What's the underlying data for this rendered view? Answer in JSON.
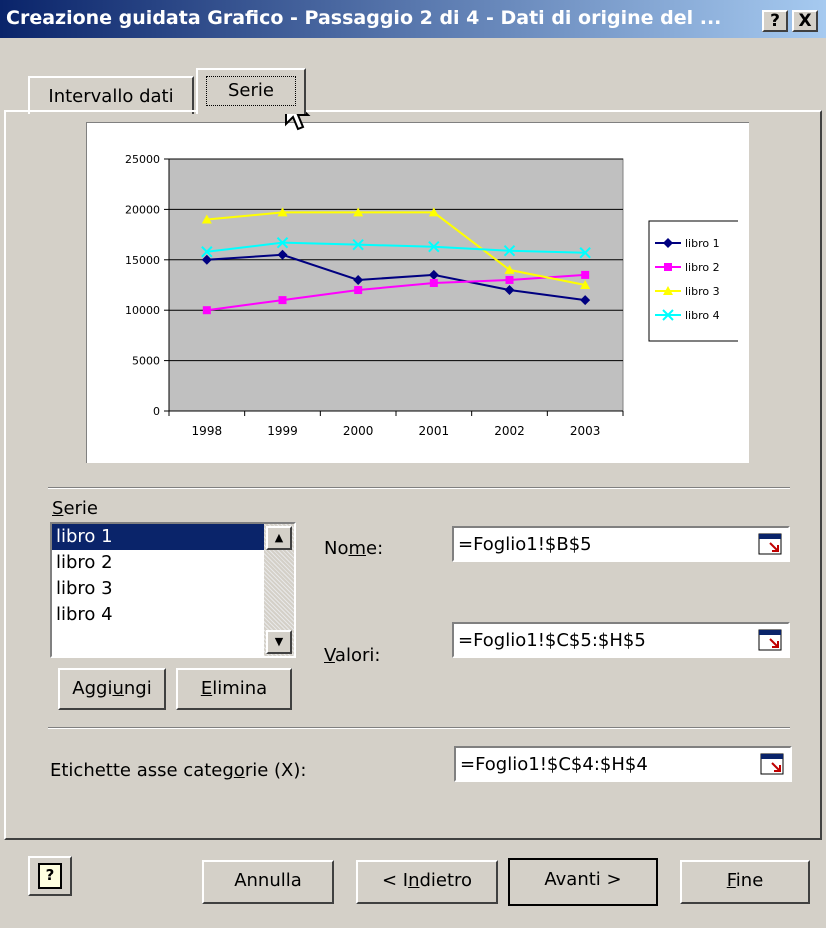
{
  "window": {
    "title": "Creazione guidata Grafico - Passaggio 2 di 4 - Dati di origine del ...",
    "help_button": "?",
    "close_button": "X"
  },
  "tabs": [
    {
      "label": "Intervallo dati",
      "active": false
    },
    {
      "label": "Serie",
      "active": true
    }
  ],
  "chart_data": {
    "type": "line",
    "categories": [
      "1998",
      "1999",
      "2000",
      "2001",
      "2002",
      "2003"
    ],
    "y_ticks": [
      "0",
      "5000",
      "10000",
      "15000",
      "20000",
      "25000"
    ],
    "ylim": [
      0,
      25000
    ],
    "grid": true,
    "legend_position": "right",
    "series": [
      {
        "name": "libro 1",
        "color": "#000080",
        "values": [
          15000,
          15500,
          13000,
          13500,
          12000,
          11000
        ]
      },
      {
        "name": "libro 2",
        "color": "#ff00ff",
        "values": [
          10000,
          11000,
          12000,
          12700,
          13000,
          13500
        ]
      },
      {
        "name": "libro 3",
        "color": "#ffff00",
        "values": [
          19000,
          19700,
          19700,
          19700,
          14000,
          12500
        ]
      },
      {
        "name": "libro 4",
        "color": "#00ffff",
        "values": [
          15800,
          16700,
          16500,
          16300,
          15900,
          15700
        ]
      }
    ]
  },
  "series_section": {
    "label_prefix": "",
    "label_key": "S",
    "label_rest": "erie",
    "items": [
      "libro 1",
      "libro 2",
      "libro 3",
      "libro 4"
    ],
    "selected_index": 0,
    "add_button": {
      "pre": "Aggi",
      "key": "u",
      "post": "ngi"
    },
    "remove_button": {
      "pre": "",
      "key": "E",
      "post": "limina"
    }
  },
  "fields": {
    "name": {
      "pre": "No",
      "key": "m",
      "post": "e:",
      "value": "=Foglio1!$B$5"
    },
    "values": {
      "pre": "",
      "key": "V",
      "post": "alori:",
      "value": "=Foglio1!$C$5:$H$5"
    },
    "category": {
      "pre": "Etichette asse categ",
      "key": "o",
      "post": "rie (X):",
      "value": "=Foglio1!$C$4:$H$4"
    }
  },
  "buttons": {
    "help": "?",
    "cancel": "Annulla",
    "back": {
      "pre": "< I",
      "key": "n",
      "post": "dietro"
    },
    "next": "Avanti >",
    "finish": {
      "pre": "",
      "key": "F",
      "post": "ine"
    }
  },
  "colors": {
    "title_start": "#0a246a",
    "title_end": "#a6caf0",
    "plot_area": "#c0c0c0",
    "selection": "#0a246a"
  }
}
